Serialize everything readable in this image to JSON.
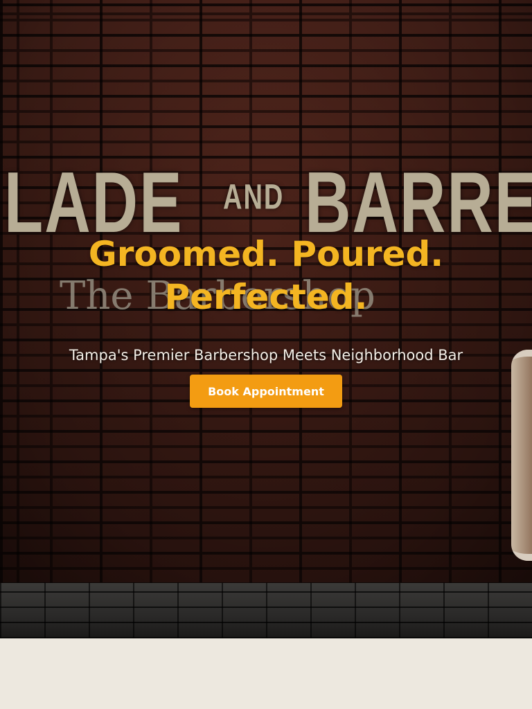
{
  "hero": {
    "sign_left": "LADE",
    "sign_and": "AND",
    "sign_right": "BARRE",
    "sign_sub": "The Barbershop",
    "headline_line1": "Groomed. Poured.",
    "headline_line2": "Perfected.",
    "tagline": "Tampa's Premier Barbershop Meets Neighborhood Bar",
    "cta_label": "Book Appointment"
  },
  "colors": {
    "accent": "#f4b522",
    "button": "#f39c12",
    "page_background": "#ede8df"
  }
}
